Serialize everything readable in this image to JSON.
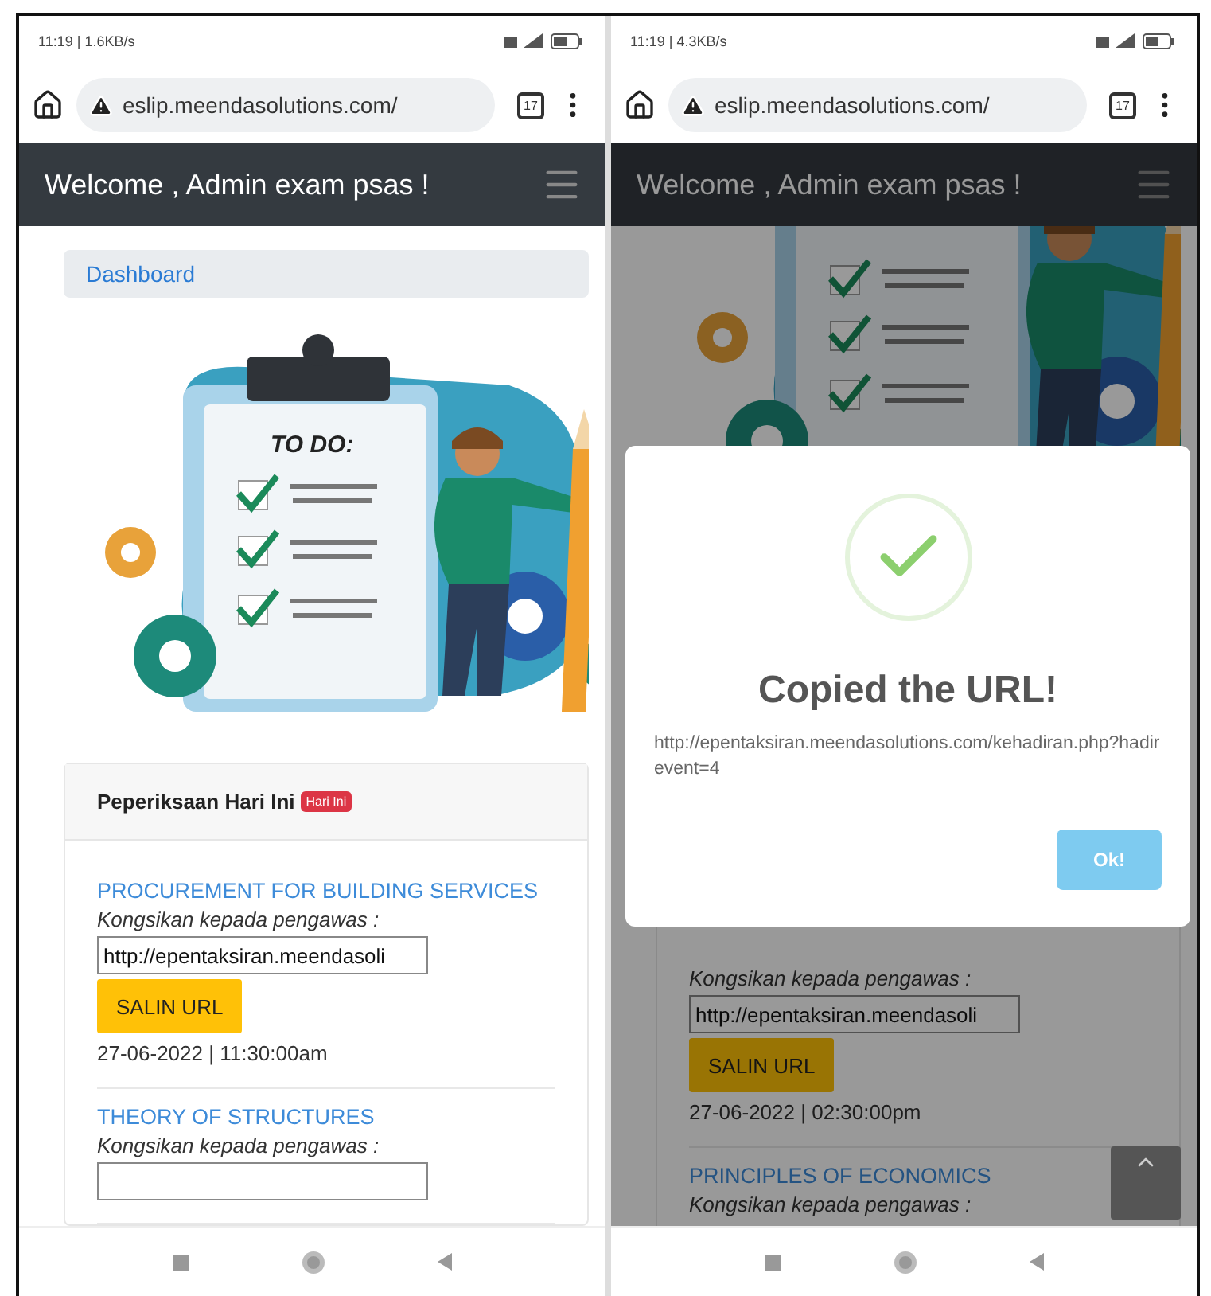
{
  "screens": [
    {
      "status_bar": {
        "time": "11:19 | 1.6KB/s"
      },
      "browser": {
        "url": "eslip.meendasolutions.com/",
        "tab_count": "17"
      },
      "header": {
        "title": "Welcome , Admin exam psas !"
      },
      "breadcrumb": "Dashboard",
      "illustration": {
        "label": "TO DO:",
        "scrolled": false
      },
      "card": {
        "title": "Peperiksaan Hari Ini",
        "badge": "Hari Ini",
        "exams": [
          {
            "title": "PROCUREMENT FOR BUILDING SERVICES",
            "label": "Kongsikan kepada pengawas :",
            "url": "http://epentaksiran.meendasoli",
            "field_shown": true,
            "button": "SALIN URL",
            "datetime": "27-06-2022 | 11:30:00am"
          },
          {
            "title": "THEORY OF STRUCTURES",
            "label": "Kongsikan kepada pengawas :",
            "field_shown": true
          }
        ]
      }
    },
    {
      "status_bar": {
        "time": "11:19 | 4.3KB/s"
      },
      "browser": {
        "url": "eslip.meendasolutions.com/",
        "tab_count": "17"
      },
      "header": {
        "title": "Welcome , Admin exam psas !"
      },
      "dimmed": true,
      "illustration": {
        "scrolled": true
      },
      "card": {
        "exams": [
          {
            "label": "Kongsikan kepada pengawas :",
            "url": "http://epentaksiran.meendasoli",
            "field_shown": true,
            "button": "SALIN URL",
            "datetime": "27-06-2022 | 02:30:00pm"
          },
          {
            "title": "PRINCIPLES OF ECONOMICS",
            "label": "Kongsikan kepada pengawas :"
          }
        ]
      },
      "scroll_top_button": true,
      "dialog": {
        "title": "Copied the URL!",
        "text": "http://epentaksiran.meendasolutions.com/kehadiran.php?hadirevent=4",
        "button": "Ok!"
      }
    }
  ]
}
